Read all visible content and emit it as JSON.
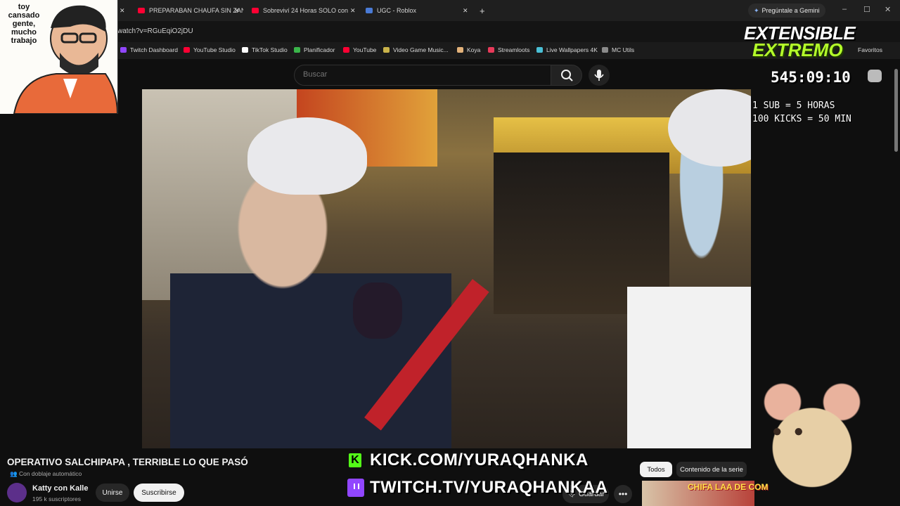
{
  "browser": {
    "tabs": [
      {
        "label": "PREPARABAN CHAUFA SIN ZAN",
        "favicon_color": "#ff0033"
      },
      {
        "label": "Sobreviví 24 Horas SOLO con S",
        "favicon_color": "#ff0033"
      },
      {
        "label": "UGC - Roblox",
        "favicon_color": "#4a7bd6"
      }
    ],
    "new_tab": "+",
    "gemini_label": "Pregúntale a Gemini",
    "window_controls": {
      "min": "–",
      "max": "☐",
      "close": "✕"
    },
    "url": "watch?v=RGuEqiO2jDU",
    "bookmarks": [
      {
        "label": "Twitch Dashboard",
        "color": "#9146ff"
      },
      {
        "label": "YouTube Studio",
        "color": "#ff0033"
      },
      {
        "label": "TikTok Studio",
        "color": "#ffffff"
      },
      {
        "label": "Planificador",
        "color": "#3ab54a"
      },
      {
        "label": "YouTube",
        "color": "#ff0033"
      },
      {
        "label": "Video Game Music...",
        "color": "#c9b34a"
      },
      {
        "label": "Koya",
        "color": "#e3b27a"
      },
      {
        "label": "Streamloots",
        "color": "#e83a5a"
      },
      {
        "label": "Live Wallpapers 4K",
        "color": "#4ac0d6"
      },
      {
        "label": "MC Utils",
        "color": "#8a8a8a"
      }
    ],
    "favorites_label": "Favoritos"
  },
  "youtube": {
    "search_placeholder": "Buscar",
    "video_title": "OPERATIVO SALCHIPAPA , TERRIBLE LO QUE PASÓ",
    "dubbing_label": "Con doblaje automático",
    "channel_name": "Katty con Kalle",
    "subscriber_count": "195 k suscriptores",
    "join_label": "Unirse",
    "subscribe_label": "Suscribirse",
    "save_label": "Guardar",
    "more_label": "•••",
    "chips": {
      "all": "Todos",
      "series": "Contenido de la serie"
    },
    "recommended_thumb_text": "CHIFA LAA DE COM"
  },
  "overlay": {
    "webcam_caption": "toy cansado gente, mucho trabajo",
    "event_title_line1": "EXTENSIBLE",
    "event_title_line2": "EXTREMO",
    "timer": "545:09:10",
    "rule_1": "1 SUB = 5 HORAS",
    "rule_2": "100 KICKS = 50 MIN",
    "kick_url": "KICK.COM/YURAQHANKA",
    "twitch_url": "TWITCH.TV/YURAQHANKAA"
  }
}
